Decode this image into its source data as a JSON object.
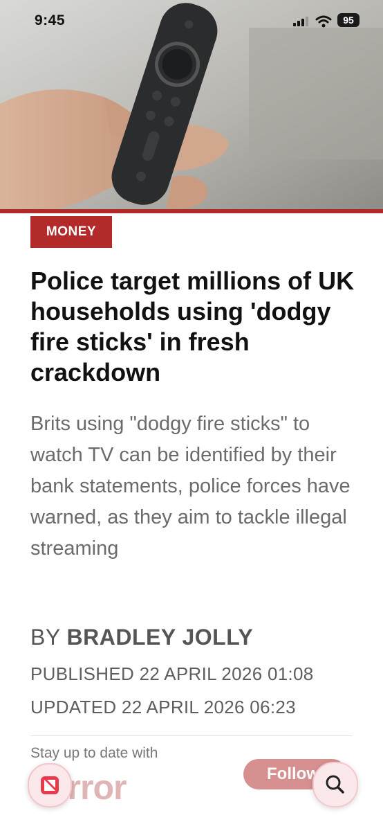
{
  "status_bar": {
    "time": "9:45",
    "battery": "95"
  },
  "article": {
    "category": "MONEY",
    "headline": "Police target millions of UK households using 'dodgy fire sticks' in fresh crackdown",
    "standfirst": "Brits using \"dodgy fire sticks\" to watch TV can be identified by their bank statements, police forces have warned, as they aim to tackle illegal streaming",
    "byline_prefix": "BY",
    "byline_name": "BRADLEY JOLLY",
    "published": "PUBLISHED 22 APRIL 2026 01:08",
    "updated": "UPDATED 22 APRIL 2026 06:23"
  },
  "follow_bar": {
    "prompt": "Stay up to date with",
    "brand": "Mirror",
    "button_label": "Follow"
  },
  "colors": {
    "accent": "#b22a2a",
    "follow": "#cf7d7d"
  }
}
